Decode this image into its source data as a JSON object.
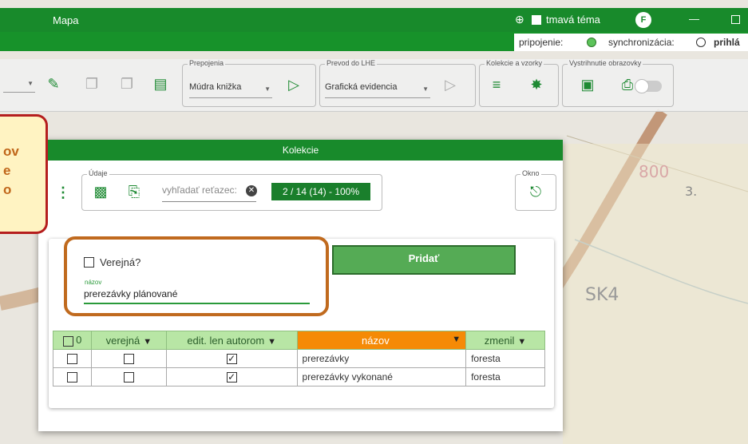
{
  "window": {
    "title": "Mapa",
    "theme_label": "tmavá téma",
    "avatar_letter": "F"
  },
  "status": {
    "connection": "pripojenie:",
    "sync": "synchronizácia:",
    "login": "prihlá"
  },
  "toolbar": {
    "group_prepojenia": "Prepojenia",
    "prepojenia_select": "Múdra knižka",
    "group_prevod": "Prevod do LHE",
    "prevod_select": "Grafická evidencia",
    "group_kolekcie": "Kolekcie a vzorky",
    "group_vystrihnutie": "Vystrihnutie obrazovky"
  },
  "dialog": {
    "title": "Kolekcie",
    "group_udaje": "Údaje",
    "group_okno": "Okno",
    "search_placeholder": "vyhľadať reťazec:",
    "counter": "2 / 14 (14) - 100%",
    "public_label": "Verejná?",
    "name_label": "názov",
    "name_value": "prerezávky plánované",
    "add_button": "Pridať"
  },
  "table": {
    "columns": [
      "0",
      "verejná",
      "edit. len autorom",
      "názov",
      "zmenil"
    ],
    "rows": [
      {
        "selected": false,
        "public": false,
        "author_only": true,
        "name": "prerezávky",
        "changed_by": "foresta"
      },
      {
        "selected": false,
        "public": false,
        "author_only": true,
        "name": "prerezávky vykonané",
        "changed_by": "foresta"
      }
    ]
  },
  "callout": {
    "line1": "ov",
    "line2": "e",
    "line3": "o"
  },
  "colors": {
    "primary_green": "#188a2b",
    "header_green": "#b8e6a5",
    "active_orange": "#f58a06",
    "highlight_brown": "#c06a1e"
  }
}
